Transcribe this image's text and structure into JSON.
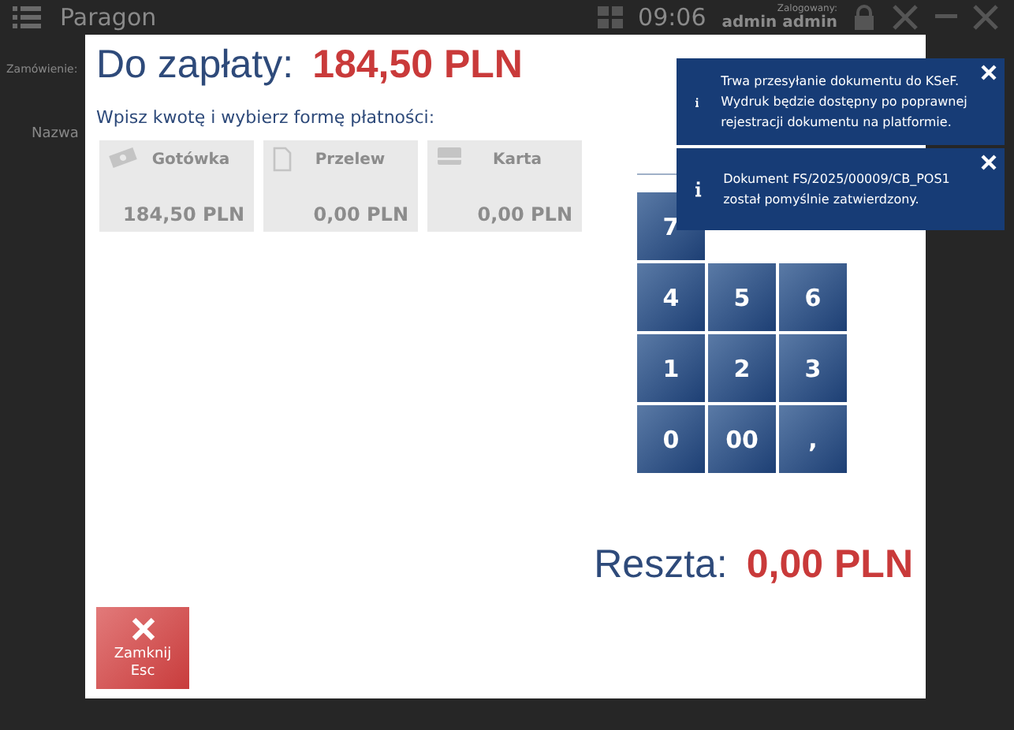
{
  "background": {
    "title": "Paragon",
    "time": "09:06",
    "logged_label": "Zalogowany:",
    "user": "admin admin",
    "order_label": "Zamówienie:",
    "column": "Nazwa"
  },
  "dialog": {
    "due_label": "Do zapłaty:",
    "due_amount": "184,50 PLN",
    "instruction": "Wpisz kwotę i wybierz formę płatności:",
    "methods": [
      {
        "kind": "cash",
        "label": "Gotówka",
        "amount": "184,50 PLN",
        "disabled": true
      },
      {
        "kind": "transfer",
        "label": "Przelew",
        "amount": "0,00 PLN",
        "disabled": true
      },
      {
        "kind": "card",
        "label": "Karta",
        "amount": "0,00 PLN",
        "disabled": true
      }
    ],
    "keypad": [
      [
        "7"
      ],
      [
        "4",
        "5",
        "6"
      ],
      [
        "1",
        "2",
        "3"
      ],
      [
        "0",
        "00",
        ","
      ]
    ],
    "change_label": "Reszta:",
    "change_amount": "0,00 PLN",
    "close_button": {
      "label": "Zamknij",
      "shortcut": "Esc"
    }
  },
  "notifications": [
    {
      "text": "Trwa przesyłanie dokumentu do KSeF. Wydruk będzie dostępny po poprawnej rejestracji dokumentu na platformie."
    },
    {
      "text": "Dokument FS/2025/00009/CB_POS1 został pomyślnie zatwierdzony."
    }
  ]
}
